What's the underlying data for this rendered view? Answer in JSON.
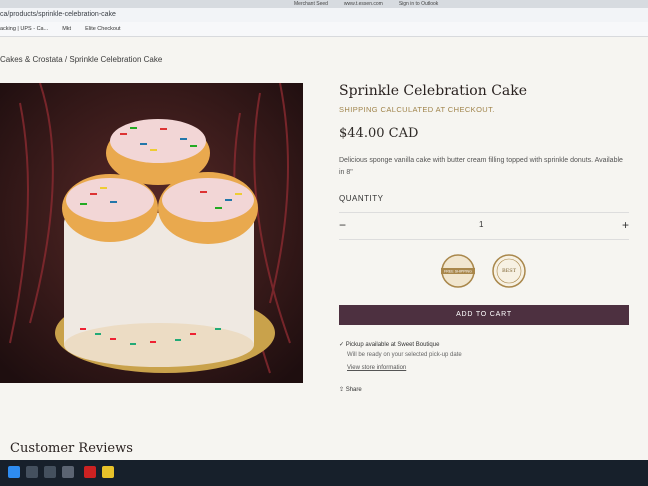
{
  "browser": {
    "tabs": [
      "",
      "",
      "",
      "Merchant Seed",
      "www.t.essen.com",
      "Sign in to Outlook"
    ],
    "url": "ca/products/sprinkle-celebration-cake",
    "bookmarks": [
      "acking | UPS - Ca...",
      "Mkt",
      "Elite Checkout"
    ]
  },
  "breadcrumb": "Cakes & Crostata / Sprinkle Celebration Cake",
  "product": {
    "title": "Sprinkle Celebration Cake",
    "shipping_note": "SHIPPING CALCULATED AT CHECKOUT.",
    "price": "$44.00 CAD",
    "description": "Delicious sponge vanilla cake with butter cream filling topped with sprinkle donuts. Available in 8\"",
    "quantity_label": "QUANTITY",
    "quantity_value": "1",
    "minus": "−",
    "plus": "+",
    "badge_free_shipping": "FREE SHIPPING",
    "badge_best": "BEST",
    "add_to_cart": "ADD TO CART",
    "pickup": "✓ Pickup available at Sweet Boutique",
    "ready": "Will be ready on your selected pick-up date",
    "store_info": "View store information",
    "share": "Share"
  },
  "reviews_title": "Customer Reviews",
  "colors": {
    "accent_gold": "#a0844b",
    "cart_button": "#4d3040",
    "page_bg": "#f6f5f1"
  }
}
